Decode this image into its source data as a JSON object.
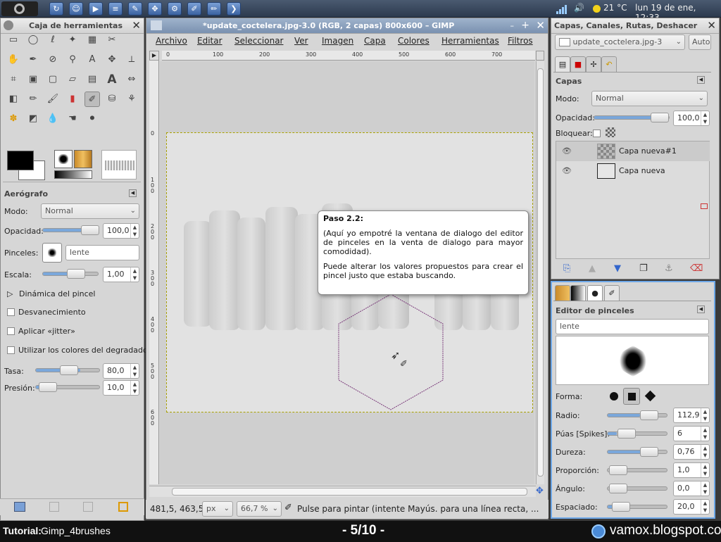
{
  "topbar": {
    "icons": [
      "gimp-logo-icon",
      "app-icon-1",
      "app-icon-2",
      "app-icon-3",
      "app-icon-4",
      "app-icon-5",
      "app-icon-6",
      "app-icon-7",
      "app-icon-8",
      "app-icon-9",
      "app-icon-10"
    ],
    "weather": "21 °C",
    "datetime": "lun 19 de ene, 12:33"
  },
  "toolbox": {
    "title": "Caja de herramientas",
    "tool_name": "Aerógrafo",
    "mode_label": "Modo:",
    "mode_value": "Normal",
    "opacity_label": "Opacidad:",
    "opacity_value": "100,0",
    "opacity_fraction": 1.0,
    "brushes_label": "Pinceles:",
    "brush_name": "lente",
    "scale_label": "Escala:",
    "scale_value": "1,00",
    "dynamics_label": "Dinámica del pincel",
    "fade_label": "Desvanecimiento",
    "jitter_label": "Aplicar «jitter»",
    "gradient_colors_label": "Utilizar los colores del degradado",
    "rate_label": "Tasa:",
    "rate_value": "80,0",
    "pressure_label": "Presión:",
    "pressure_value": "10,0"
  },
  "image_window": {
    "title": "*update_coctelera.jpg-3.0 (RGB, 2 capas) 800x600 – GIMP",
    "menus": [
      "Archivo",
      "Editar",
      "Seleccionar",
      "Ver",
      "Imagen",
      "Capa",
      "Colores",
      "Herramientas",
      "Filtros"
    ],
    "ruler_h": [
      "0",
      "100",
      "200",
      "300",
      "400",
      "500",
      "600",
      "700"
    ],
    "ruler_v": [
      "0",
      "1\n0\n0",
      "2\n0\n0",
      "3\n0\n0",
      "4\n0\n0",
      "5\n0\n0",
      "6\n0\n0"
    ],
    "coords": "481,5, 463,5",
    "unit": "px",
    "zoom": "66,7 %",
    "status": "Pulse para pintar (intente Mayús. para una línea recta, ..."
  },
  "tooltip": {
    "title": "Paso 2.2:",
    "p1": "(Aquí yo empotré la ventana de dialogo del editor de pinceles en la venta de dialogo para mayor comodidad).",
    "p2": "Puede alterar los valores propuestos para crear el pincel justo que estaba buscando."
  },
  "layers_dock": {
    "title": "Capas, Canales, Rutas, Deshacer",
    "image_select": "update_coctelera.jpg-3",
    "auto": "Auto",
    "section": "Capas",
    "mode_label": "Modo:",
    "mode_value": "Normal",
    "opacity_label": "Opacidad:",
    "opacity_value": "100,0",
    "lock_label": "Bloquear:",
    "layers": [
      "Capa nueva#1",
      "Capa nueva"
    ]
  },
  "brush_editor": {
    "title": "Editor de pinceles",
    "name": "lente",
    "shape_label": "Forma:",
    "radius_label": "Radio:",
    "radius_value": "112,9",
    "spikes_label": "Púas [Spikes]:",
    "spikes_value": "6",
    "hardness_label": "Dureza:",
    "hardness_value": "0,76",
    "ratio_label": "Proporción:",
    "ratio_value": "1,0",
    "angle_label": "Ángulo:",
    "angle_value": "0,0",
    "spacing_label": "Espaciado:",
    "spacing_value": "20,0"
  },
  "bottombar": {
    "tutorial_label": "Tutorial:",
    "tutorial_name": "Gimp_4brushes",
    "page": "- 5/10 -",
    "site": "vamox.blogspot.com"
  }
}
